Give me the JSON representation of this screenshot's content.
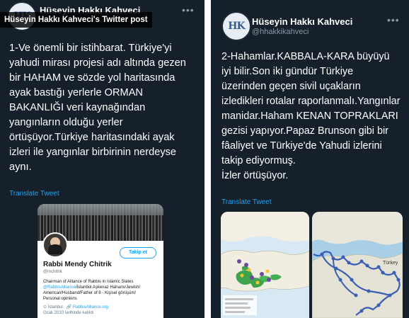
{
  "caption": "Hüseyin Hakkı Kahveci's Twitter post",
  "left_tweet": {
    "username": "Hüseyin Hakkı Kahveci",
    "avatar_initials": "HK",
    "text": "1-Ve önemli bir istihbarat.  Türkiye'yi\nyahudi mirası projesi adı altında gezen\nbir HAHAM ve sözde yol haritasında\nayak bastığı yerlerle ORMAN\nBAKANLIĞI veri kaynağından\nyangınların olduğu yerler\nörtüşüyor.Türkiye haritasındaki ayak\nizleri ile yangınlar birbirinin nerdeyse\naynı.",
    "translate": "Translate Tweet",
    "card": {
      "follow": "Takip et",
      "name": "Rabbi Mendy Chitrik",
      "handle": "@mchitrik",
      "bio_line1": "Chairman of Alliance of Rabbis in Islamic States",
      "bio_mention": "@RabbisAlliance",
      "bio_rest": "/İstanbul Aşkenaz Hahamı/Jewish/\nAmerican/Husband/Father of 8 - Kişisel görüşüm/\nPersonal opinions",
      "location": "İstanbul",
      "website": "RabbisAlliance.org",
      "joined": "Ocak 2010 tarihinde katıldı"
    }
  },
  "right_tweet": {
    "username": "Hüseyin Hakkı Kahveci",
    "handle": "@hhakkikahveci",
    "avatar_initials": "HK",
    "text": "2-Hahamlar.KABBALA-KARA büyüyü\niyi bilir.Son iki gündür Türkiye\nüzerinden geçen sivil uçakların\nizledikleri rotalar raporlanmalı.Yangınlar\nmanidar.Haham KENAN TOPRAKLARI\ngezisi yapıyor.Papaz Brunson gibi bir\nfâaliyet ve Türkiye'de Yahudi izlerini\ntakip ediyormuş.\nİzler örtüşüyor.",
    "translate": "Translate Tweet",
    "map_label": "Türkey"
  },
  "colors": {
    "background": "#15202b",
    "accent": "#1da1f2",
    "text": "#ffffff",
    "muted": "#8899a6"
  }
}
